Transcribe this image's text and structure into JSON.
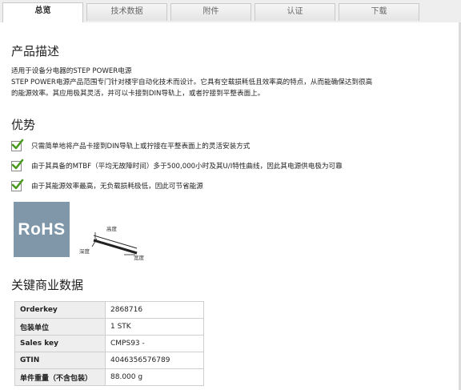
{
  "tabs": [
    {
      "label": "总览",
      "active": true
    },
    {
      "label": "技术数据",
      "active": false
    },
    {
      "label": "附件",
      "active": false
    },
    {
      "label": "认证",
      "active": false
    },
    {
      "label": "下载",
      "active": false
    }
  ],
  "description": {
    "title": "产品描述",
    "lines": [
      "适用于设备分电器的STEP POWER电源",
      "STEP POWER电源产品范围专门针对楼宇自动化技术而设计。它具有空载损耗低且效率高的特点，从而能确保达到很高",
      "的能源效率。其应用极其灵活，并可以卡接到DIN导轨上，或者拧接到平整表面上。"
    ]
  },
  "advantages": {
    "title": "优势",
    "items": [
      "只需简单地将产品卡接到DIN导轨上或拧接在平整表面上的灵活安装方式",
      "由于其具备的MTBF（平均无故障时间）多于500,000小时及其U/I特性曲线，因此其电源供电极为可靠",
      "由于其能源效率最高，无负载损耗极低，因此可节省能源"
    ]
  },
  "images": {
    "rohs_logo": "RoHS",
    "dimension_labels": {
      "height": "高度",
      "depth": "深度",
      "width": "宽度"
    }
  },
  "key_data": {
    "title": "关键商业数据",
    "rows": [
      {
        "key": "Orderkey",
        "value": "2868716"
      },
      {
        "key": "包装单位",
        "value": "1 STK"
      },
      {
        "key": "Sales key",
        "value": "CMPS93 -"
      },
      {
        "key": "GTIN",
        "value": "4046356576789"
      },
      {
        "key": "单件重量（不含包装）",
        "value": "88.000 g"
      }
    ]
  },
  "colors": {
    "rohs_bg": "#7f97a8",
    "check_green": "#4a9a1e",
    "table_key_bg": "#eeeeee"
  }
}
